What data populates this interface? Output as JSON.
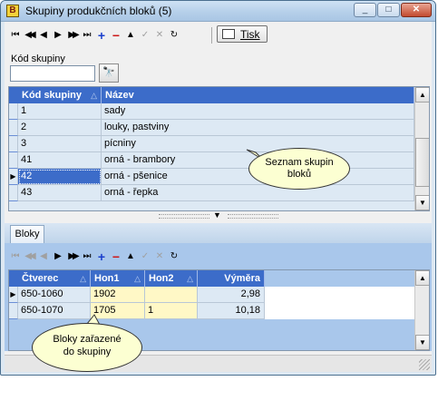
{
  "window": {
    "title": "Skupiny produkčních bloků (5)",
    "app_icon_glyph": "B",
    "controls": {
      "minimize": "_",
      "maximize": "□",
      "close": "✕"
    }
  },
  "toolbar_top": {
    "buttons": [
      {
        "name": "first-record-button",
        "glyph": "⏮"
      },
      {
        "name": "prev-page-button",
        "glyph": "◀◀"
      },
      {
        "name": "prev-record-button",
        "glyph": "◀"
      },
      {
        "name": "next-record-button",
        "glyph": "▶"
      },
      {
        "name": "next-page-button",
        "glyph": "▶▶"
      },
      {
        "name": "last-record-button",
        "glyph": "⏭"
      },
      {
        "name": "add-record-button",
        "glyph": "+"
      },
      {
        "name": "delete-record-button",
        "glyph": "−"
      },
      {
        "name": "edit-record-button",
        "glyph": "▲"
      },
      {
        "name": "post-record-button",
        "glyph": "✓"
      },
      {
        "name": "cancel-record-button",
        "glyph": "✕"
      },
      {
        "name": "refresh-button",
        "glyph": "↻"
      }
    ],
    "print_label": "Tisk"
  },
  "search": {
    "label": "Kód skupiny",
    "value": "",
    "button_glyph": "🔭"
  },
  "groups_grid": {
    "columns": [
      "Kód skupiny",
      "Název"
    ],
    "sort_glyph": "△",
    "selected_marker": "▶",
    "rows": [
      {
        "code": "1",
        "name": "sady",
        "selected": false
      },
      {
        "code": "2",
        "name": "louky, pastviny",
        "selected": false
      },
      {
        "code": "3",
        "name": "pícniny",
        "selected": false
      },
      {
        "code": "41",
        "name": "orná - brambory",
        "selected": false
      },
      {
        "code": "42",
        "name": "orná - pšenice",
        "selected": true
      },
      {
        "code": "43",
        "name": "orná - řepka",
        "selected": false
      }
    ]
  },
  "callout_groups": "Seznam skupin bloků",
  "tabs": [
    "Bloky"
  ],
  "toolbar_bottom": {
    "buttons": [
      {
        "name": "first-record-button",
        "glyph": "⏮",
        "enabled": false
      },
      {
        "name": "prev-page-button",
        "glyph": "◀◀",
        "enabled": false
      },
      {
        "name": "prev-record-button",
        "glyph": "◀",
        "enabled": false
      },
      {
        "name": "next-record-button",
        "glyph": "▶",
        "enabled": true
      },
      {
        "name": "next-page-button",
        "glyph": "▶▶",
        "enabled": true
      },
      {
        "name": "last-record-button",
        "glyph": "⏭",
        "enabled": true
      },
      {
        "name": "add-record-button",
        "glyph": "+",
        "enabled": true
      },
      {
        "name": "delete-record-button",
        "glyph": "−",
        "enabled": true
      },
      {
        "name": "edit-record-button",
        "glyph": "▲",
        "enabled": true
      },
      {
        "name": "post-record-button",
        "glyph": "✓",
        "enabled": false
      },
      {
        "name": "cancel-record-button",
        "glyph": "✕",
        "enabled": false
      },
      {
        "name": "refresh-button",
        "glyph": "↻",
        "enabled": true
      }
    ]
  },
  "blocks_grid": {
    "columns": [
      "Čtverec",
      "Hon1",
      "Hon2",
      "Výměra"
    ],
    "sort_glyph": "△",
    "rows": [
      {
        "ctverec": "650-1060",
        "hon1": "1902",
        "hon2": "",
        "vymera": "2,98",
        "selected": true
      },
      {
        "ctverec": "650-1070",
        "hon1": "1705",
        "hon2": "1",
        "vymera": "10,18",
        "selected": false
      }
    ]
  },
  "callout_blocks": "Bloky zařazené do skupiny",
  "colors": {
    "grid_header": "#3c6cc9",
    "row_bg": "#dde9f4",
    "hon_column_bg": "#fff8c6",
    "selected_cell": "#3c6cc9",
    "callout_bg": "#fcffd2"
  }
}
